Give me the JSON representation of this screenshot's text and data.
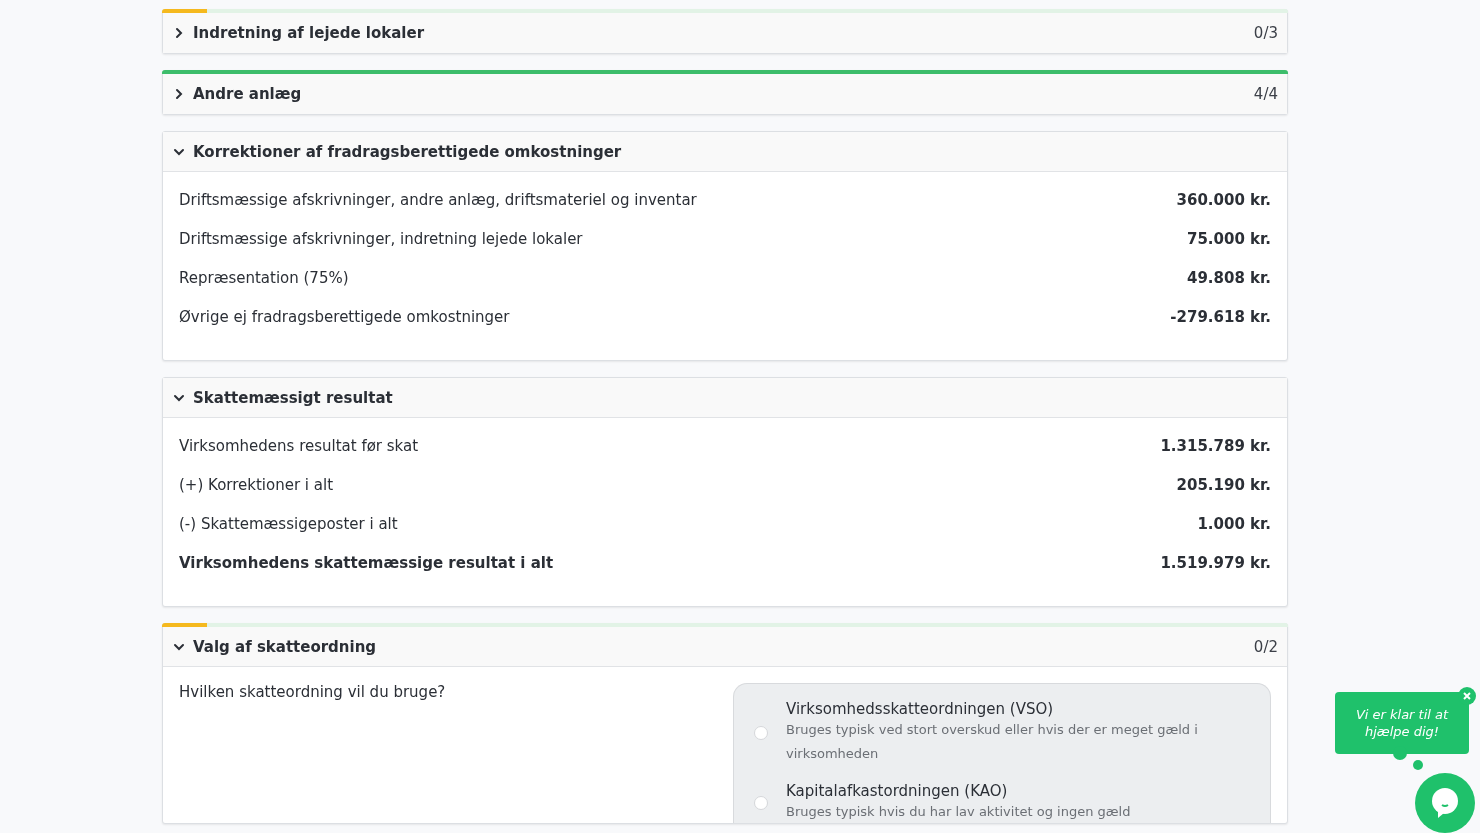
{
  "sections": [
    {
      "title": "Indretning af lejede lokaler",
      "expanded": false,
      "count": "0/3",
      "progress": {
        "level": 0.04
      }
    },
    {
      "title": "Andre anlæg",
      "expanded": false,
      "count": "4/4",
      "progress": {
        "level": 1
      }
    },
    {
      "kind": "amounts",
      "title": "Korrektioner af fradragsberettigede omkostninger",
      "expanded": true,
      "rows": [
        {
          "label": "Driftsmæssige afskrivninger, andre anlæg, driftsmateriel og inventar",
          "value": "360.000 kr.",
          "total": false
        },
        {
          "label": "Driftsmæssige afskrivninger, indretning lejede lokaler",
          "value": "75.000 kr.",
          "total": false
        },
        {
          "label": "Repræsentation (75%)",
          "value": "49.808 kr.",
          "total": false
        },
        {
          "label": "Øvrige ej fradragsberettigede omkostninger",
          "value": "-279.618 kr.",
          "total": false
        }
      ]
    },
    {
      "kind": "amounts",
      "title": "Skattemæssigt resultat",
      "expanded": true,
      "rows": [
        {
          "label": "Virksomhedens resultat før skat",
          "value": "1.315.789 kr.",
          "total": false
        },
        {
          "label": "(+) Korrektioner i alt",
          "value": "205.190 kr.",
          "total": false
        },
        {
          "label": "(-) Skattemæssigeposter i alt",
          "value": "1.000 kr.",
          "total": false
        },
        {
          "label": "Virksomhedens skattemæssige resultat i alt",
          "value": "1.519.979 kr.",
          "total": true
        }
      ]
    },
    {
      "kind": "choice",
      "title": "Valg af skatteordning",
      "expanded": true,
      "count": "0/2",
      "progress": {
        "level": 0.04
      },
      "question": "Hvilken skatteordning vil du bruge?",
      "options": [
        {
          "label": "Virksomhedsskatteordningen (VSO)",
          "description": "Bruges typisk ved stort overskud eller hvis der er meget gæld i virksomheden",
          "selected": false
        },
        {
          "label": "Kapitalafkastordningen (KAO)",
          "description": "Bruges typisk hvis du har lav aktivitet og ingen gæld",
          "selected": false
        }
      ]
    }
  ],
  "chat": {
    "message": "Vi er klar til at hjælpe dig!"
  }
}
